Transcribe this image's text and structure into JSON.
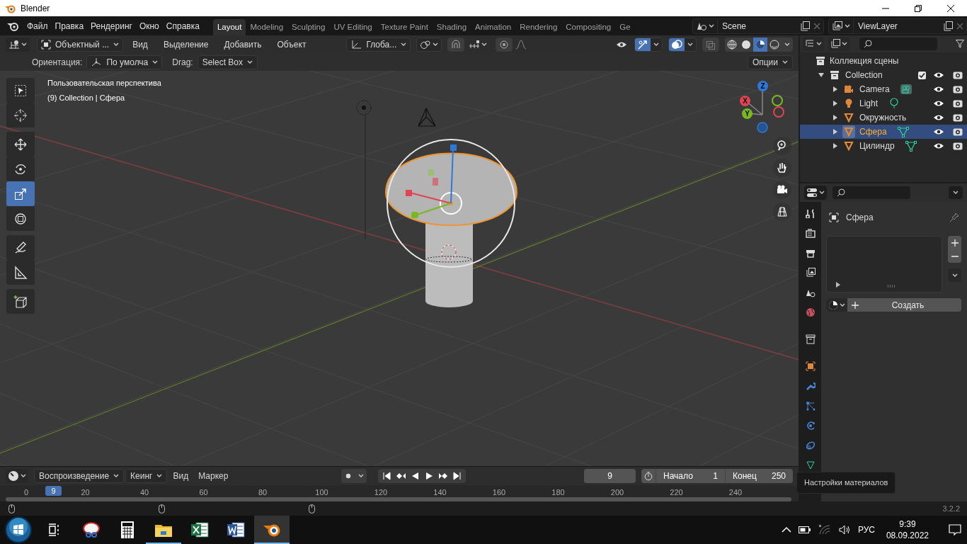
{
  "window": {
    "title": "Blender"
  },
  "menu": [
    "Файл",
    "Правка",
    "Рендеринг",
    "Окно",
    "Справка"
  ],
  "workspace_tabs": [
    {
      "label": "Layout",
      "selected": true
    },
    {
      "label": "Modeling",
      "selected": false
    },
    {
      "label": "Sculpting",
      "selected": false
    },
    {
      "label": "UV Editing",
      "selected": false
    },
    {
      "label": "Texture Paint",
      "selected": false
    },
    {
      "label": "Shading",
      "selected": false
    },
    {
      "label": "Animation",
      "selected": false
    },
    {
      "label": "Rendering",
      "selected": false
    },
    {
      "label": "Compositing",
      "selected": false
    },
    {
      "label": "Ge",
      "selected": false
    }
  ],
  "scene": "Scene",
  "view_layer": "ViewLayer",
  "viewport_header": {
    "mode": "Объектный ...",
    "menus": [
      "Вид",
      "Выделение",
      "Добавить",
      "Объект"
    ],
    "orientation": "Глоба...",
    "snap_on": false,
    "proportional_on": false,
    "gizmos_on": true,
    "overlays_on": true,
    "xray_on": false,
    "shading": [
      {
        "kind": "wireframe",
        "selected": false
      },
      {
        "kind": "solid",
        "selected": false
      },
      {
        "kind": "material",
        "selected": true
      },
      {
        "kind": "rendered",
        "selected": false
      }
    ]
  },
  "tool_settings": {
    "orientation_label": "Ориентация:",
    "orientation_value": "По умолча",
    "drag_label": "Drag:",
    "drag_value": "Select Box",
    "options": "Опции"
  },
  "viewport": {
    "view_name": "Пользовательская перспектива",
    "context": "(9) Collection | Сфера",
    "tools": [
      {
        "kind": "select",
        "selected": false
      },
      {
        "kind": "cursor",
        "selected": false
      },
      {
        "kind": "move",
        "selected": false
      },
      {
        "kind": "rotate",
        "selected": false
      },
      {
        "kind": "scale",
        "selected": true
      },
      {
        "kind": "transform",
        "selected": false
      },
      {
        "kind": "annotate",
        "selected": false
      },
      {
        "kind": "measure",
        "selected": false
      },
      {
        "kind": "add_cube",
        "selected": false
      }
    ],
    "gizmo_axes": [
      {
        "label": "Z",
        "color": "#2e78d8"
      },
      {
        "label": "X",
        "color": "#e04452"
      },
      {
        "label": "Y",
        "color": "#78b820"
      }
    ]
  },
  "outliner": {
    "title": "Коллекция сцены",
    "children": [
      {
        "label": "Collection",
        "kind": "collection",
        "expanded": true,
        "checked": true,
        "selected": false,
        "children": [
          {
            "label": "Camera",
            "kind": "camera",
            "expanded": false,
            "selected": false
          },
          {
            "label": "Light",
            "kind": "light",
            "expanded": false,
            "selected": false
          },
          {
            "label": "Окружность",
            "kind": "curve",
            "expanded": false,
            "selected": false
          },
          {
            "label": "Сфера",
            "kind": "mesh",
            "expanded": false,
            "selected": true
          },
          {
            "label": "Цилиндр",
            "kind": "mesh",
            "expanded": false,
            "selected": false
          }
        ]
      }
    ]
  },
  "properties": {
    "object_name": "Сфера",
    "new_button": "Создать",
    "tooltip": "Настройки материалов"
  },
  "timeline": {
    "menus": [
      "Воспроизведение",
      "Кеинг",
      "Вид",
      "Маркер"
    ],
    "auto_key_on": false,
    "current_frame": "9",
    "start_label": "Начало",
    "start": "1",
    "end_label": "Конец",
    "end": "250",
    "ruler": [
      "0",
      "20",
      "40",
      "60",
      "80",
      "100",
      "120",
      "140",
      "160",
      "180",
      "200",
      "220",
      "240"
    ],
    "badge": "9"
  },
  "status_bar": {
    "version": "3.2.2"
  },
  "taskbar": {
    "apps": [
      {
        "kind": "task_view",
        "active": false,
        "open": false
      },
      {
        "kind": "snipping",
        "active": false,
        "open": false
      },
      {
        "kind": "calculator",
        "active": false,
        "open": false
      },
      {
        "kind": "explorer",
        "active": false,
        "open": true
      },
      {
        "kind": "excel",
        "active": false,
        "open": false
      },
      {
        "kind": "word",
        "active": false,
        "open": false
      },
      {
        "kind": "blender",
        "active": true,
        "open": true
      }
    ],
    "language": "РУС",
    "time": "9:39",
    "date": "08.09.2022"
  }
}
